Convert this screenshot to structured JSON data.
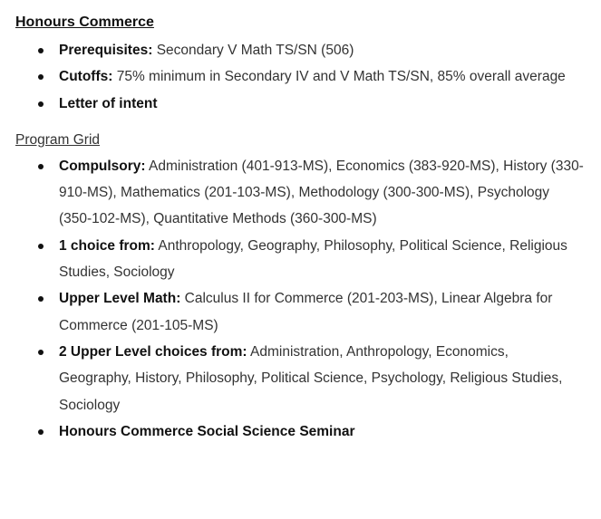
{
  "section_title": "Honours Commerce",
  "requirements": [
    {
      "label": "Prerequisites:",
      "text": " Secondary V Math TS/SN (506)"
    },
    {
      "label": "Cutoffs:",
      "text": " 75% minimum in Secondary IV and V Math TS/SN, 85% overall average"
    },
    {
      "label": "Letter of intent",
      "text": ""
    }
  ],
  "grid_link": "Program Grid",
  "grid": [
    {
      "label": "Compulsory:",
      "text": " Administration (401-913-MS), Economics (383-920-MS), History (330-910-MS), Mathematics (201-103-MS), Methodology (300-300-MS), Psychology (350-102-MS), Quantitative Methods (360-300-MS)"
    },
    {
      "label": "1 choice from:",
      "text": " Anthropology, Geography, Philosophy, Political Science, Religious Studies, Sociology"
    },
    {
      "label": "Upper Level Math:",
      "text": " Calculus II for Commerce (201-203-MS), Linear Algebra for Commerce (201-105-MS)"
    },
    {
      "label": "2 Upper Level choices from:",
      "text": " Administration, Anthropology, Economics, Geography, History, Philosophy, Political Science, Psychology, Religious Studies, Sociology"
    },
    {
      "label": "Honours Commerce Social Science Seminar",
      "text": ""
    }
  ]
}
